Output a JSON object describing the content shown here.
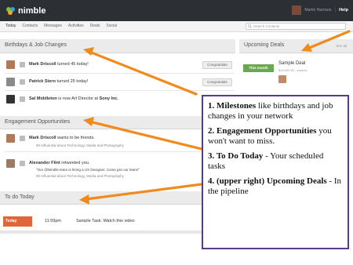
{
  "app": {
    "logo": "nimble",
    "user_name": "Martin Harrison",
    "help": "Help"
  },
  "nav": {
    "tabs": [
      "Today",
      "Contacts",
      "Messages",
      "Activities",
      "Deals",
      "Social"
    ],
    "search_placeholder": "Search Contacts"
  },
  "birthdays": {
    "title": "Birthdays & Job Changes",
    "items": [
      {
        "name": "Mark Driscoll",
        "text": "turned 45 today!",
        "button": "Congratulate"
      },
      {
        "name": "Patrick Stern",
        "text": "turned 25 today!",
        "button": "Congratulate"
      },
      {
        "name": "Sal Middleton",
        "text": "is now Art Director at",
        "company": "Sony Inc.",
        "button": "Congratulate"
      }
    ]
  },
  "engagement": {
    "title": "Engagement Opportunities",
    "items": [
      {
        "name": "Mark Driscoll",
        "text": "wants to be friends.",
        "sub": "90 Influential about Technology, Media and Photography"
      },
      {
        "name": "Alexander Flint",
        "text": "retweeted you.",
        "quote": "\"Our @Nimble team is hiring a UX Designer. Come join our team!\"",
        "sub": "90 Influential about Technology, Media and Photography"
      }
    ]
  },
  "todo": {
    "title": "To do Today",
    "badge": "Today",
    "time": "11:59pm",
    "task": "Sample Task: Watch this video"
  },
  "deals": {
    "title": "Upcoming Deals",
    "see_all": "See all",
    "badge": "This month",
    "name": "Sample Deal",
    "amount": "$18,000.00 - expires"
  },
  "annotation": {
    "items": [
      {
        "num": "1.",
        "bold": "Milestones",
        "rest": " like birthdays and job changes in your network"
      },
      {
        "num": "2.",
        "bold": "Engagement Opportunities",
        "rest": " you won't want to miss."
      },
      {
        "num": "3.",
        "bold": "To Do Today",
        "rest": " - Your scheduled tasks"
      },
      {
        "num": "4.",
        "bold": "(upper right) Upcoming Deals",
        "rest": " - In the pipeline"
      }
    ]
  },
  "colors": {
    "topbar": "#2c2f33",
    "arrow": "#f08a1c",
    "today_badge": "#e0663a",
    "month_badge": "#6aa84f",
    "note_border": "#5b3a8c"
  }
}
